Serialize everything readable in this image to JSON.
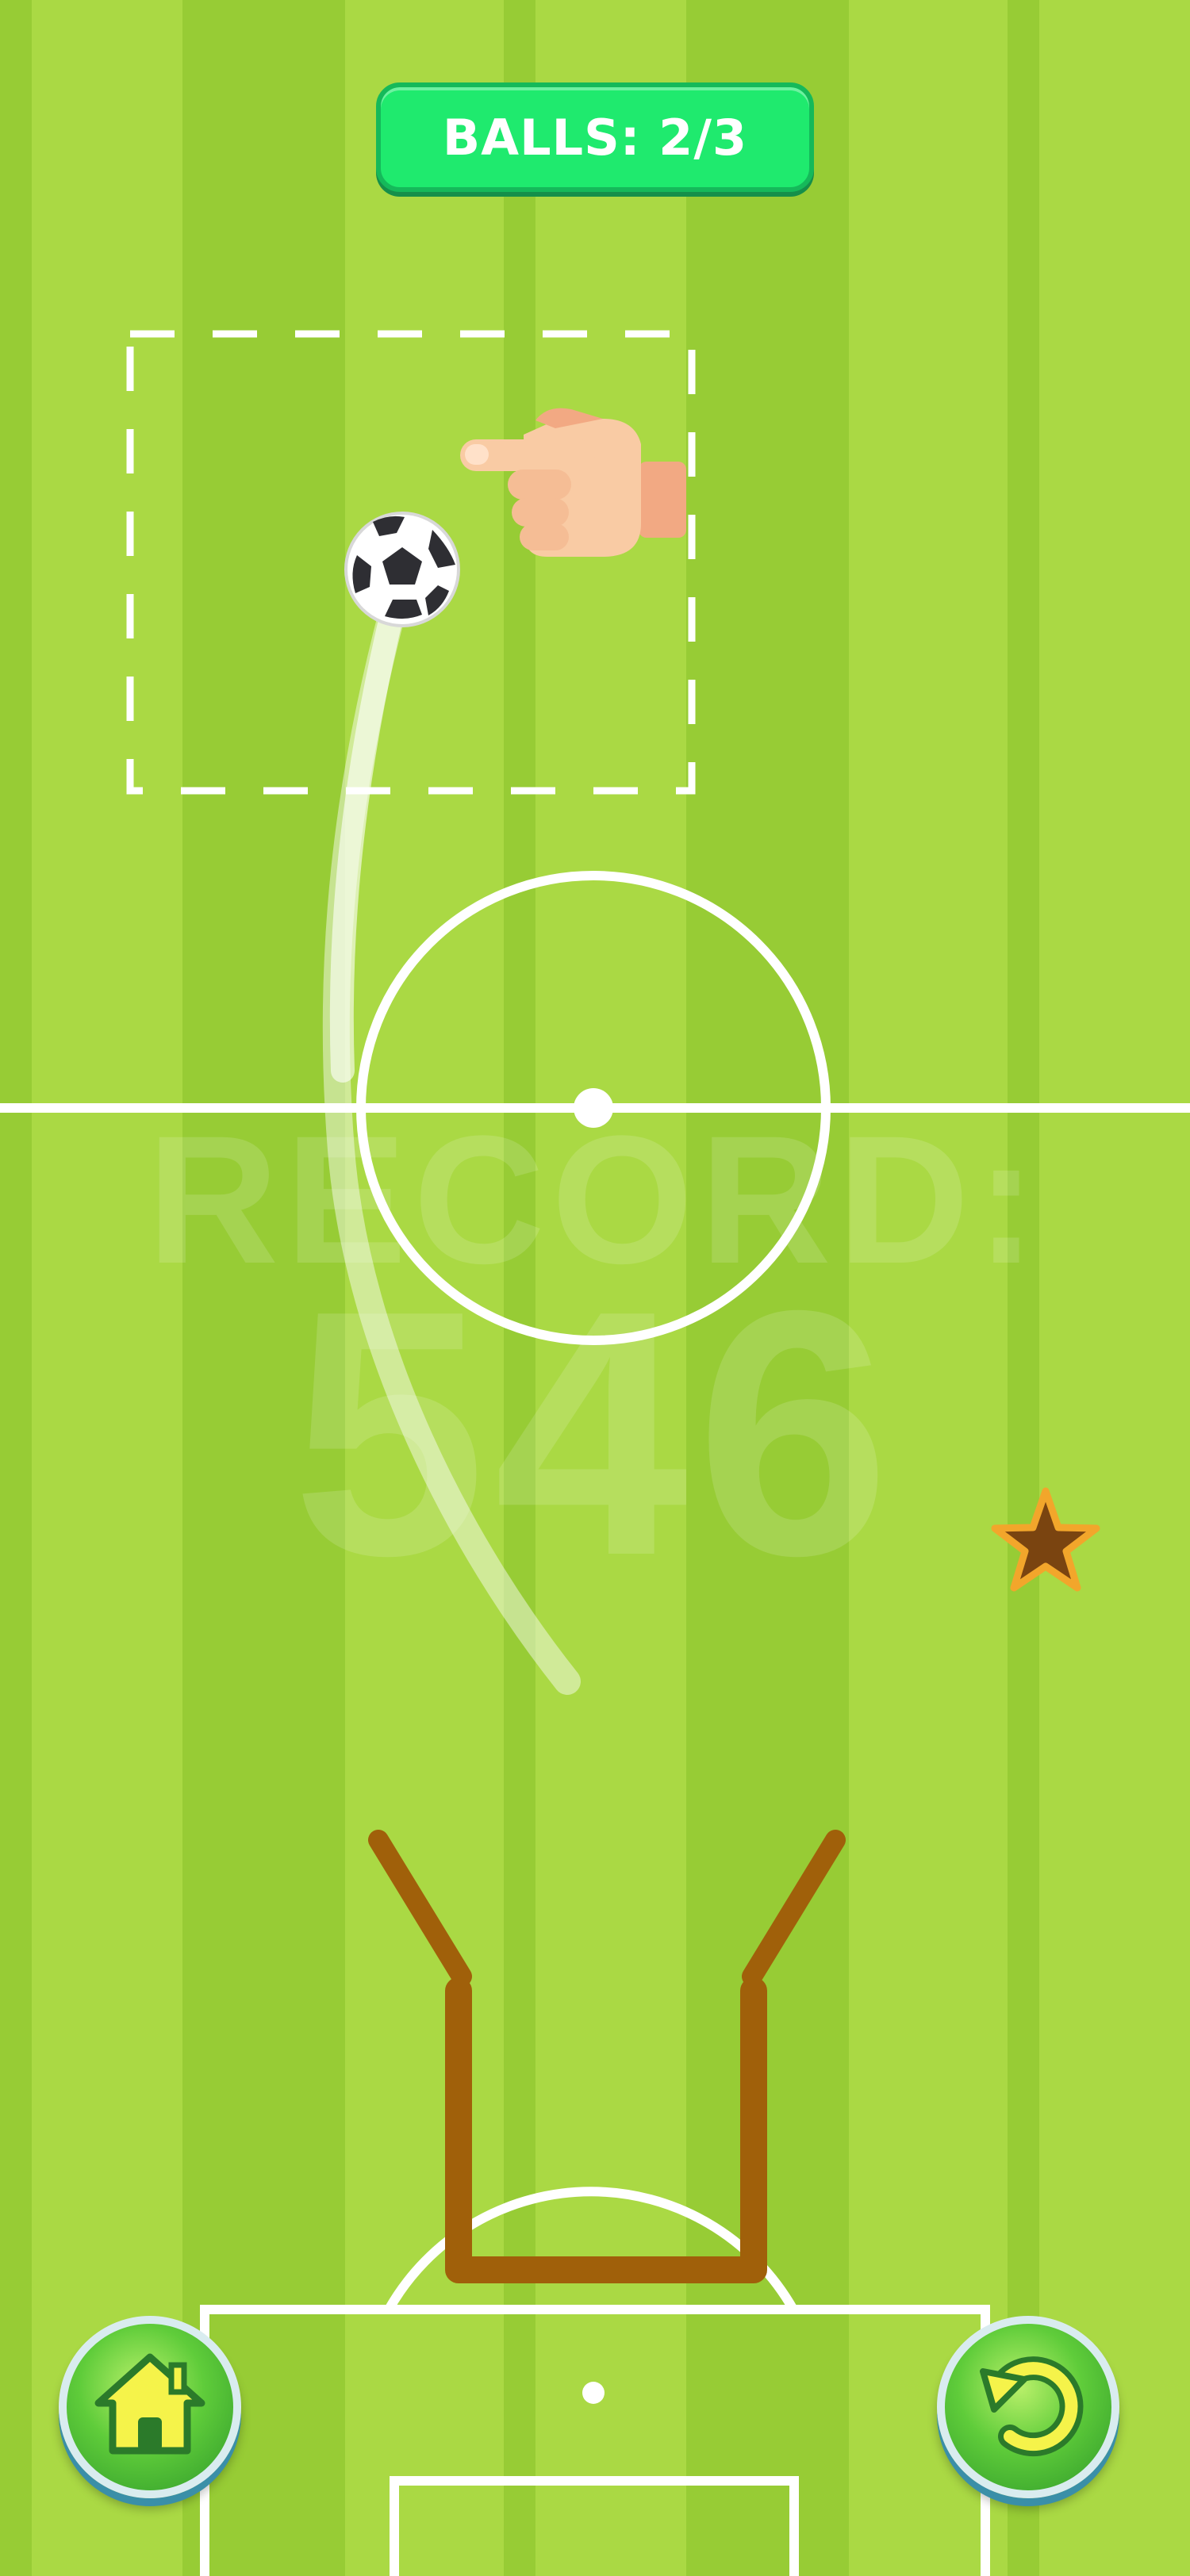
{
  "hud": {
    "balls_text": "BALLS: 2/3"
  },
  "background_score": {
    "label": "RECORD:",
    "value": "546"
  },
  "buttons": {
    "home": {
      "icon": "home-icon"
    },
    "restart": {
      "icon": "restart-icon"
    }
  },
  "colors": {
    "grass_dark": "#97cc35",
    "grass_light": "#aad944",
    "pill_green": "#1fea6e",
    "goal_brown": "#a0600a",
    "button_green": "#5fcc3a"
  }
}
